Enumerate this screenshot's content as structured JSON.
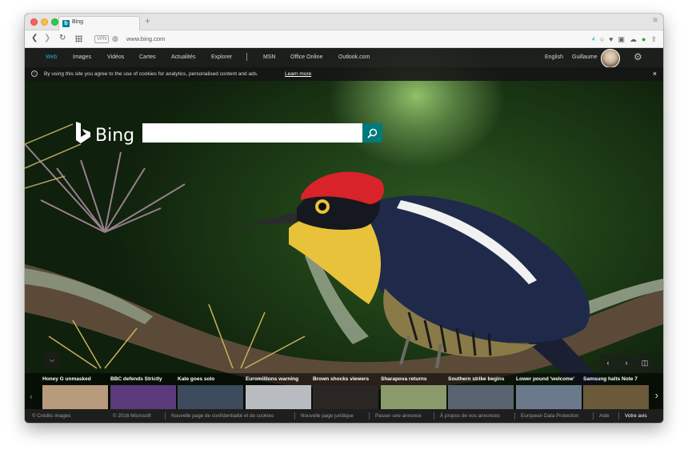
{
  "browser": {
    "tab_title": "Bing",
    "favicon_letter": "b",
    "new_tab_symbol": "+",
    "menu_symbol": "≡",
    "url": "www.bing.com",
    "vpn_label": "VPN",
    "toolbar_count": "4"
  },
  "header": {
    "nav": [
      {
        "label": "Web"
      },
      {
        "label": "Images"
      },
      {
        "label": "Vidéos"
      },
      {
        "label": "Cartes"
      },
      {
        "label": "Actualités"
      },
      {
        "label": "Explorer"
      },
      {
        "label": "MSN"
      },
      {
        "label": "Office Online"
      },
      {
        "label": "Outlook.com"
      }
    ],
    "language": "English",
    "user": "Guillaume",
    "active_color": "#2ba8d8"
  },
  "cookie": {
    "text": "By using this site you agree to the use of cookies for analytics, personalised content and ads.",
    "link": "Learn more",
    "close": "×"
  },
  "search": {
    "logo": "Bing",
    "placeholder": "",
    "button_color": "#007a7a"
  },
  "image_controls": {
    "prev": "‹",
    "next": "›",
    "camera": "📷",
    "collapse": "⌵"
  },
  "news": {
    "prev": "‹",
    "next": "›",
    "items": [
      {
        "caption": "Honey G unmasked",
        "color": "#b89a7c"
      },
      {
        "caption": "BBC defends Strictly",
        "color": "#5a3a7a"
      },
      {
        "caption": "Kate goes solo",
        "color": "#3d4c5c"
      },
      {
        "caption": "Euromillions warning",
        "color": "#b8bcc0"
      },
      {
        "caption": "Brown shocks viewers",
        "color": "#2a2624"
      },
      {
        "caption": "Sharapova returns",
        "color": "#8a9a6a"
      },
      {
        "caption": "Southern strike begins",
        "color": "#5a6470"
      },
      {
        "caption": "Lower pound 'welcome'",
        "color": "#6a7a8c"
      },
      {
        "caption": "Samsung halts Note 7",
        "color": "#6a5a3a"
      }
    ]
  },
  "footer": {
    "credits": "© Crédits images",
    "copyright": "© 2016 Microsoft",
    "links": [
      "Nouvelle page de confidentialité et de cookies",
      "Nouvelle page juridique",
      "Passer une annonce",
      "À propos de nos annonces",
      "European Data Protection",
      "Aide"
    ],
    "feedback": "Votre avis"
  }
}
